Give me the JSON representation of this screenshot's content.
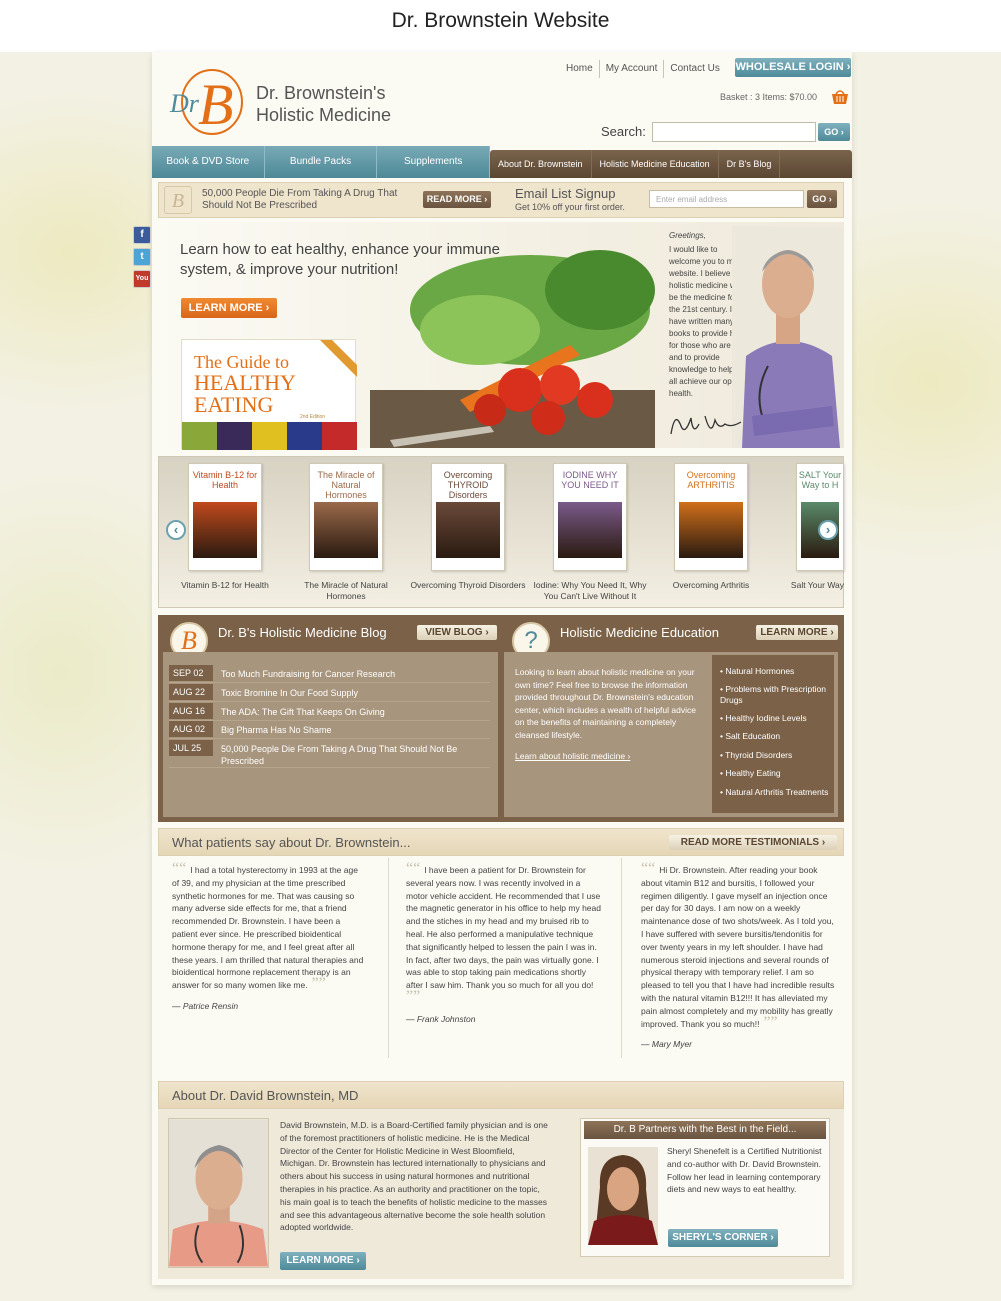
{
  "caption": "Dr. Brownstein Website",
  "header": {
    "logo_monogram": "DrB",
    "logo_line1": "Dr. Brownstein's",
    "logo_line2": "Holistic Medicine",
    "top_links": [
      "Home",
      "My Account",
      "Contact Us"
    ],
    "wholesale_label": "WHOLESALE LOGIN ›",
    "basket": "Basket : 3 Items: $70.00",
    "search_label": "Search:",
    "search_go": "GO ›"
  },
  "nav": {
    "left": [
      "Book & DVD Store",
      "Bundle Packs",
      "Supplements"
    ],
    "right": [
      "About Dr. Brownstein",
      "Holistic Medicine Education",
      "Dr B's Blog"
    ]
  },
  "promo": {
    "icon_letter": "B",
    "text": "50,000 People Die From Taking A Drug That Should Not Be Prescribed",
    "read_more": "READ MORE ›",
    "email_title": "Email List Signup",
    "email_sub": "Get 10% off your first order.",
    "email_placeholder": "Enter email address",
    "email_go": "GO ›"
  },
  "social": {
    "facebook": "f",
    "twitter": "t",
    "youtube": "You"
  },
  "hero": {
    "title": "Learn how to eat healthy, enhance your immune system, & improve your nutrition!",
    "learn_more": "LEARN MORE ›",
    "book_line1": "The Guide to",
    "book_line2": "HEALTHY",
    "book_line3": "EATING",
    "book_edition": "2nd Edition",
    "greeting_title": "Greetings,",
    "greeting_text": "I would like to welcome you to my website. I believe holistic medicine will be the medicine for the 21st century. I have written many books to provide hope for those who are ill and to provide knowledge to help us all achieve our optimal health."
  },
  "carousel": {
    "prev": "‹",
    "next": "›",
    "books": [
      {
        "cover": "Vitamin B-12 for Health",
        "caption": "Vitamin B-12 for Health",
        "color": "#c04a1c"
      },
      {
        "cover": "The Miracle of Natural Hormones",
        "caption": "The Miracle of Natural Hormones",
        "color": "#9a6a4a"
      },
      {
        "cover": "Overcoming THYROID Disorders",
        "caption": "Overcoming Thyroid Disorders",
        "color": "#6a4a3a"
      },
      {
        "cover": "IODINE WHY YOU NEED IT",
        "caption": "Iodine: Why You Need It, Why You Can't Live Without It",
        "color": "#7a5a8a"
      },
      {
        "cover": "Overcoming ARTHRITIS",
        "caption": "Overcoming Arthritis",
        "color": "#d0701a"
      },
      {
        "cover": "SALT Your Way to H",
        "caption": "Salt Your Way",
        "color": "#5a8a6a"
      }
    ]
  },
  "blog": {
    "title": "Dr. B's Holistic Medicine Blog",
    "button": "VIEW BLOG ›",
    "posts": [
      {
        "date": "SEP 02",
        "title": "Too Much Fundraising for Cancer Research"
      },
      {
        "date": "AUG 22",
        "title": "Toxic Bromine In Our Food Supply"
      },
      {
        "date": "AUG 16",
        "title": "The ADA: The Gift That Keeps On Giving"
      },
      {
        "date": "AUG 02",
        "title": "Big Pharma Has No Shame"
      },
      {
        "date": "JUL 25",
        "title": "50,000 People Die From Taking A Drug That Should Not Be Prescribed"
      }
    ]
  },
  "education": {
    "title": "Holistic Medicine Education",
    "button": "LEARN MORE ›",
    "text": "Looking to learn about holistic medicine on your own time? Feel free to browse the information provided throughout Dr. Brownstein's education center, which includes a wealth of helpful advice on the benefits of maintaining a completely cleansed lifestyle.",
    "link": "Learn about holistic medicine ›",
    "topics": [
      "• Natural Hormones",
      "• Problems with Prescription Drugs",
      "• Healthy Iodine Levels",
      "• Salt Education",
      "• Thyroid Disorders",
      "• Healthy Eating",
      "• Natural Arthritis Treatments"
    ]
  },
  "testimonials": {
    "title": "What patients say about Dr. Brownstein...",
    "button": "READ MORE TESTIMONIALS ›",
    "items": [
      {
        "text": "I had a total hysterectomy in 1993 at the age of 39, and my physician at the time prescribed synthetic hormones for me. That was causing so many adverse side effects for me, that a friend recommended Dr. Brownstein. I have been a patient ever since. He prescribed bioidentical hormone therapy for me, and I feel great after all these years. I am thrilled that natural therapies and bioidentical hormone replacement therapy is an answer for so many women like me.",
        "author": "— Patrice Rensin"
      },
      {
        "text": "I have been a patient for Dr. Brownstein for several years now. I was recently involved in a motor vehicle accident. He recommended that I use the magnetic generator in his office to help my head and the stiches in my head and my bruised rib to heal. He also performed a manipulative technique that significantly helped to lessen the pain I was in. In fact, after two days, the pain was virtually gone. I was able to stop taking pain medications shortly after I saw him. Thank you so much for all you do!",
        "author": "— Frank Johnston"
      },
      {
        "text": "Hi Dr. Brownstein. After reading your book about vitamin B12 and bursitis, I followed your regimen diligently. I gave myself an injection once per day for 30 days. I am now on a weekly maintenance dose of two shots/week. As I told you, I have suffered with severe bursitis/tendonitis for over twenty years in my left shoulder. I have had numerous steroid injections and several rounds of physical therapy with temporary relief. I am so pleased to tell you that I have had incredible results with the natural vitamin B12!!! It has alleviated my pain almost completely and my mobility has greatly improved. Thank you so much!!",
        "author": "— Mary Myer"
      }
    ]
  },
  "about": {
    "title": "About Dr. David Brownstein, MD",
    "text": "David Brownstein, M.D. is a Board-Certified family physician and is one of the foremost practitioners of holistic medicine. He is the Medical Director of the Center for Holistic Medicine in West Bloomfield, Michigan. Dr. Brownstein has lectured internationally to physicians and others about his success in using natural hormones and nutritional therapies in his practice. As an authority and practitioner on the topic, his main goal is to teach the benefits of holistic medicine to the masses and see this advantageous alternative become the sole health solution adopted worldwide.",
    "learn_more": "LEARN MORE ›",
    "partner_title": "Dr. B Partners with the Best in the Field...",
    "partner_text": "Sheryl Shenefelt is a Certified Nutritionist and co-author with Dr. David Brownstein. Follow her lead in learning contemporary diets and new ways to eat healthy.",
    "partner_button": "SHERYL'S CORNER ›"
  },
  "colors": {
    "teal": "#4e8a99",
    "brown": "#7a6148",
    "orange": "#e36f16"
  }
}
